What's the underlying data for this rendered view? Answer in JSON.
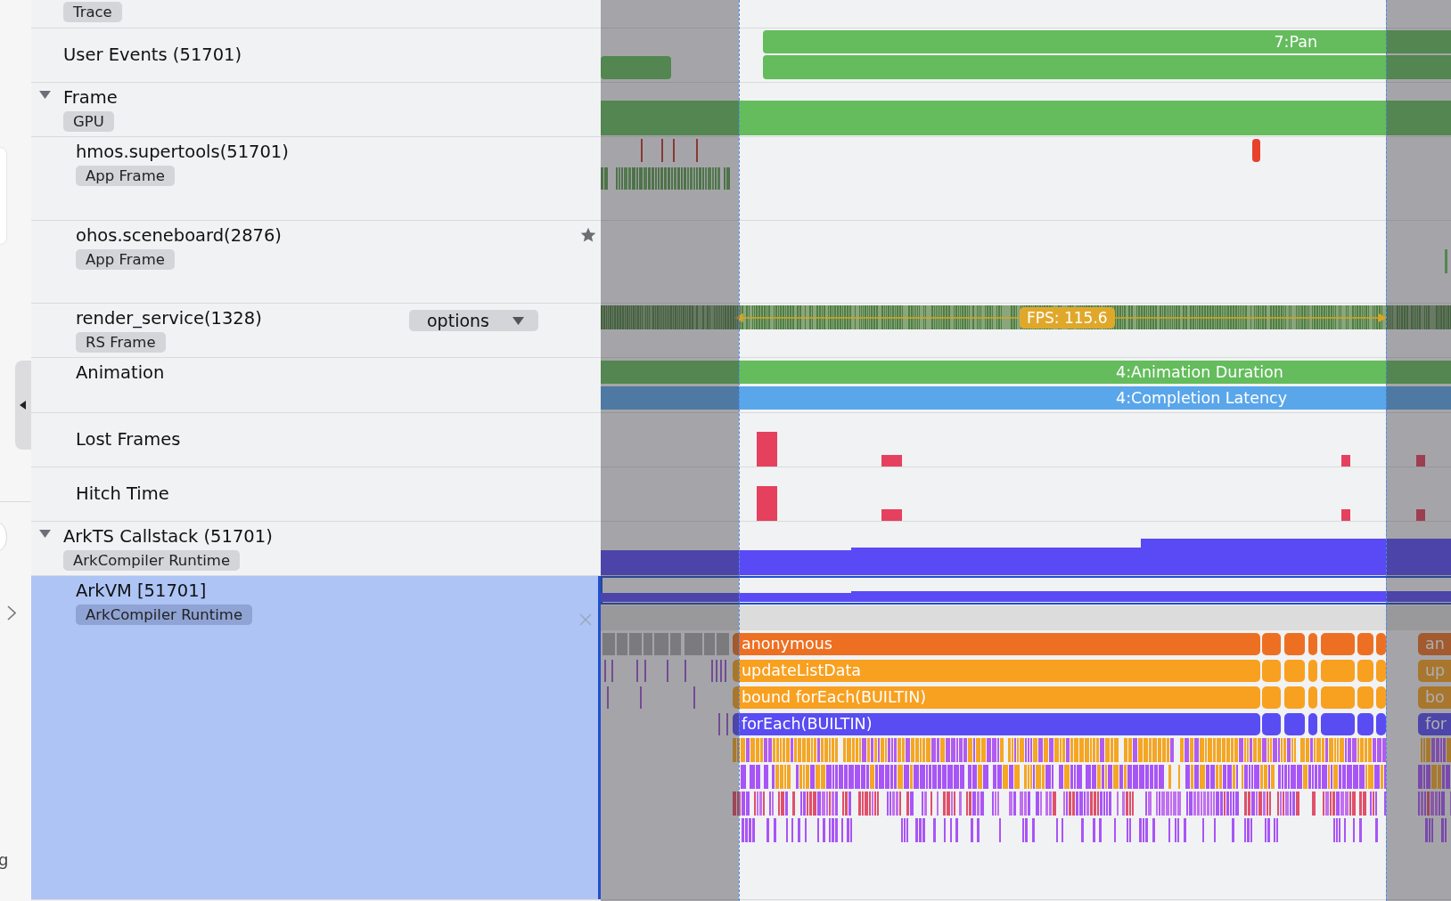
{
  "left_edge": {
    "text": "g"
  },
  "tracks": [
    {
      "kind": "trace",
      "tag": "Trace",
      "selected": false,
      "starred": false
    },
    {
      "kind": "user_events",
      "title": "User Events (51701)",
      "selected": false,
      "starred": false,
      "slices": [
        {
          "label": "7:Pan"
        }
      ]
    },
    {
      "kind": "frame_group",
      "title": "Frame",
      "tag": "GPU",
      "expanded": true,
      "selected": false,
      "starred": false,
      "children": [
        {
          "kind": "app_frame",
          "title": "hmos.supertools(51701)",
          "tag": "App Frame",
          "selected": false,
          "starred": false
        },
        {
          "kind": "app_frame_idle",
          "title": "ohos.sceneboard(2876)",
          "tag": "App Frame",
          "selected": false,
          "starred": true
        },
        {
          "kind": "rs_frame",
          "title": "render_service(1328)",
          "tag": "RS Frame",
          "selected": false,
          "starred": false,
          "options": "options",
          "fps_label": "FPS: 115.6"
        },
        {
          "kind": "animation",
          "title": "Animation",
          "selected": false,
          "starred": false,
          "slices": [
            {
              "label": "4:Animation Duration",
              "color": "#64bc5c"
            },
            {
              "label": "4:Completion Latency",
              "color": "#5aa6ea"
            }
          ]
        },
        {
          "kind": "jank",
          "title": "Lost Frames",
          "selected": false,
          "starred": false
        },
        {
          "kind": "jank",
          "title": "Hitch Time",
          "selected": false,
          "starred": false
        }
      ]
    },
    {
      "kind": "callstack",
      "title": "ArkTS Callstack (51701)",
      "tag": "ArkCompiler Runtime",
      "expanded": true,
      "selected": false,
      "starred": false,
      "children": [
        {
          "kind": "arkvm",
          "title": "ArkVM [51701]",
          "tag": "ArkCompiler Runtime",
          "selected": true,
          "starred": false,
          "frames": [
            {
              "label": "anonymous",
              "cut_label": "an",
              "color": "#ed7022"
            },
            {
              "label": "updateListData",
              "cut_label": "up",
              "color": "#f8a020"
            },
            {
              "label": "bound forEach(BUILTIN)",
              "cut_label": "bo",
              "color": "#f8a020"
            },
            {
              "label": "forEach(BUILTIN)",
              "cut_label": "for",
              "color": "#5a4cf3"
            }
          ]
        }
      ]
    }
  ]
}
